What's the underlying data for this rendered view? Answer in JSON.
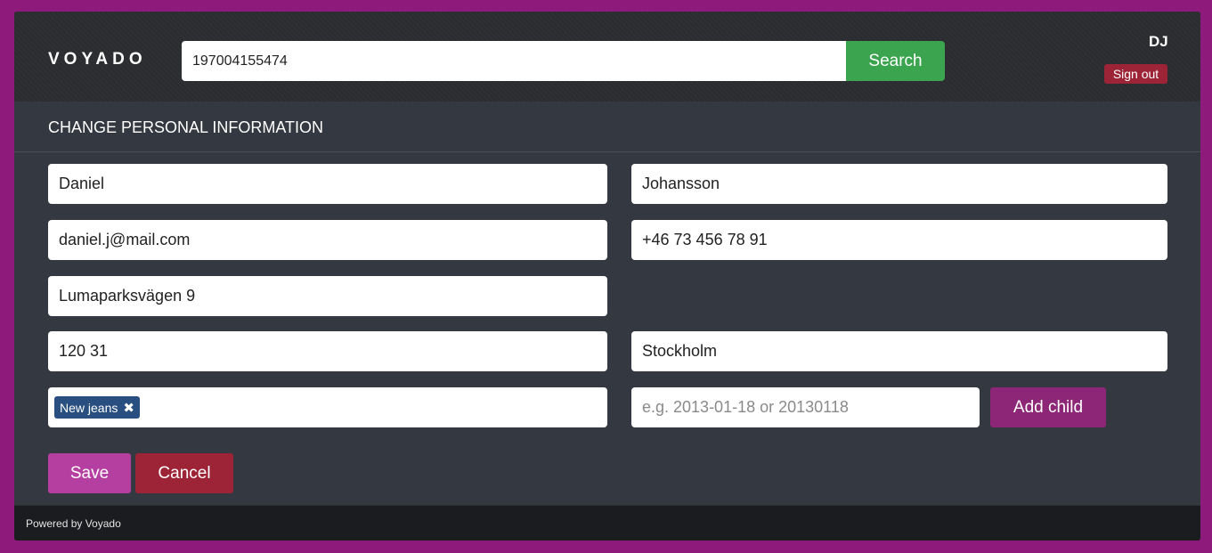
{
  "header": {
    "logo": "VOYADO",
    "search_value": "197004155474",
    "search_label": "Search",
    "user_initials": "DJ",
    "signout_label": "Sign out"
  },
  "page_title": "CHANGE PERSONAL INFORMATION",
  "form": {
    "first_name": "Daniel",
    "last_name": "Johansson",
    "email": "daniel.j@mail.com",
    "phone": "+46 73 456 78 91",
    "street": "Lumaparksvägen 9",
    "zip": "120 31",
    "city": "Stockholm",
    "tags": [
      "New jeans"
    ],
    "tag_remove_glyph": "✖",
    "child_date_placeholder": "e.g. 2013-01-18 or 20130118",
    "add_child_label": "Add child",
    "save_label": "Save",
    "cancel_label": "Cancel"
  },
  "footer": {
    "text": "Powered by Voyado"
  },
  "colors": {
    "page_border": "#8e1a7c",
    "panel": "#343840",
    "header": "#2b2d30",
    "search_button": "#3aa54e",
    "signout": "#9d2436",
    "tag": "#284f80",
    "add_child": "#8e2677",
    "save": "#b43fa0",
    "cancel": "#9d2436",
    "footer": "#1b1c1f"
  }
}
